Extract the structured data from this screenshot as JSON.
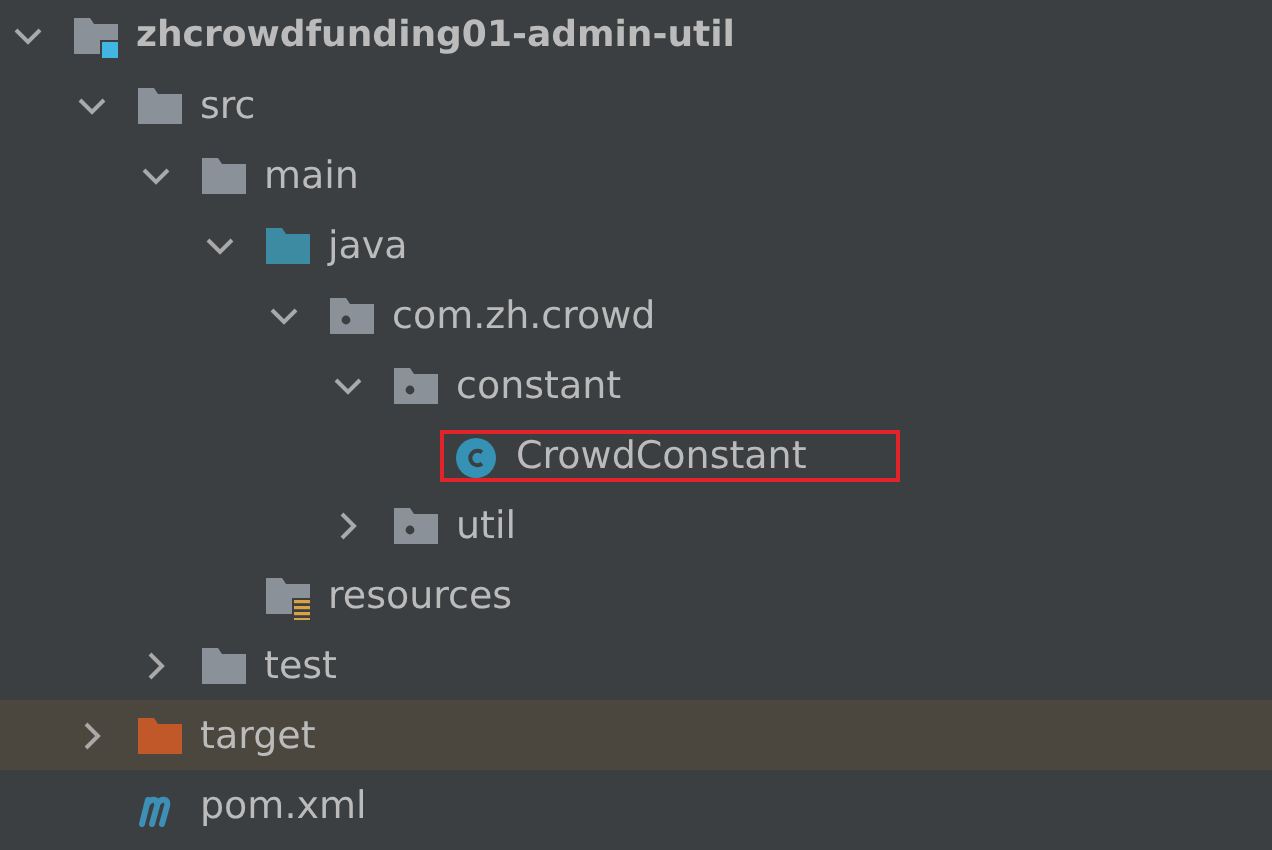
{
  "tree": [
    {
      "label": "zhcrowdfunding01-admin-util",
      "kind": "module",
      "expanded": true,
      "selected": false,
      "boxed": false,
      "children": [
        {
          "label": "src",
          "kind": "folder",
          "expanded": true,
          "selected": false,
          "boxed": false,
          "children": [
            {
              "label": "main",
              "kind": "folder",
              "expanded": true,
              "selected": false,
              "boxed": false,
              "children": [
                {
                  "label": "java",
                  "kind": "source-folder",
                  "expanded": true,
                  "selected": false,
                  "boxed": false,
                  "children": [
                    {
                      "label": "com.zh.crowd",
                      "kind": "package",
                      "expanded": true,
                      "selected": false,
                      "boxed": false,
                      "children": [
                        {
                          "label": "constant",
                          "kind": "package",
                          "expanded": true,
                          "selected": false,
                          "boxed": false,
                          "children": [
                            {
                              "label": "CrowdConstant",
                              "kind": "class",
                              "selected": false,
                              "boxed": true
                            }
                          ]
                        },
                        {
                          "label": "util",
                          "kind": "package",
                          "expanded": false,
                          "selected": false,
                          "boxed": false
                        }
                      ]
                    }
                  ]
                },
                {
                  "label": "resources",
                  "kind": "resources",
                  "selected": false,
                  "boxed": false
                }
              ]
            },
            {
              "label": "test",
              "kind": "folder",
              "expanded": false,
              "selected": false,
              "boxed": false
            }
          ]
        },
        {
          "label": "target",
          "kind": "excluded",
          "expanded": false,
          "selected": true,
          "boxed": false
        },
        {
          "label": "pom.xml",
          "kind": "maven",
          "selected": false,
          "boxed": false
        }
      ]
    }
  ]
}
